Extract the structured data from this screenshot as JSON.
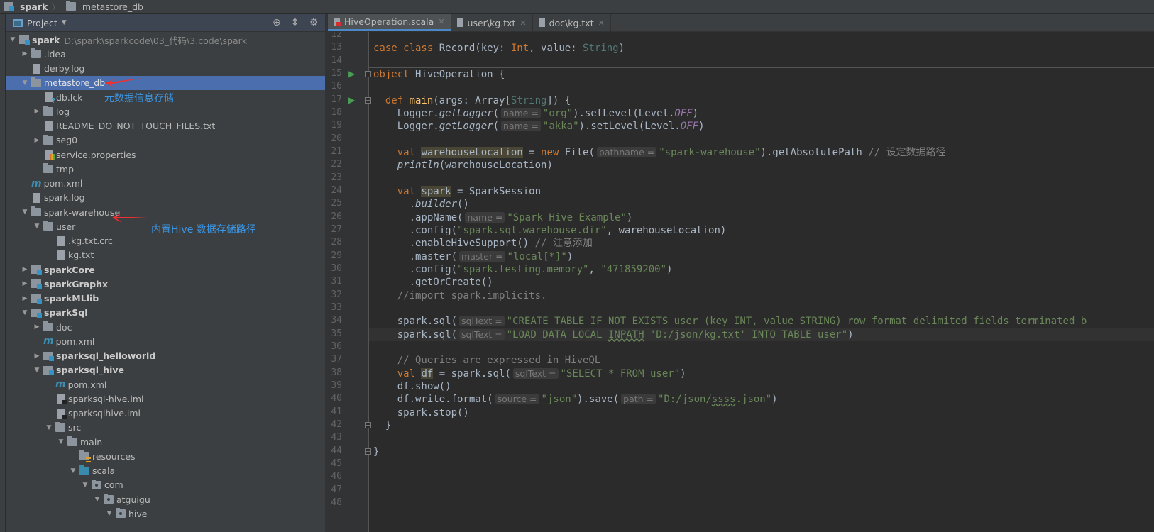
{
  "breadcrumb": {
    "project": "spark",
    "folder": "metastore_db"
  },
  "project_panel": {
    "title": "Project",
    "icons": [
      "locate-icon",
      "collapse-icon",
      "gear-icon"
    ]
  },
  "tree": [
    {
      "label": "spark",
      "level": 0,
      "arrow": "open",
      "icon": "module",
      "bold": true,
      "path": "D:\\spark\\sparkcode\\03_代码\\3.code\\spark"
    },
    {
      "label": ".idea",
      "level": 1,
      "arrow": "closed",
      "icon": "folder"
    },
    {
      "label": "derby.log",
      "level": 1,
      "arrow": "",
      "icon": "file"
    },
    {
      "label": "metastore_db",
      "level": 1,
      "arrow": "open",
      "icon": "folder",
      "selected": true
    },
    {
      "label": "db.lck",
      "level": 2,
      "arrow": "",
      "icon": "lock"
    },
    {
      "label": "log",
      "level": 2,
      "arrow": "closed",
      "icon": "folder"
    },
    {
      "label": "README_DO_NOT_TOUCH_FILES.txt",
      "level": 2,
      "arrow": "",
      "icon": "file"
    },
    {
      "label": "seg0",
      "level": 2,
      "arrow": "closed",
      "icon": "folder"
    },
    {
      "label": "service.properties",
      "level": 2,
      "arrow": "",
      "icon": "props"
    },
    {
      "label": "tmp",
      "level": 2,
      "arrow": "",
      "icon": "folder"
    },
    {
      "label": "pom.xml",
      "level": 1,
      "arrow": "",
      "icon": "maven"
    },
    {
      "label": "spark.log",
      "level": 1,
      "arrow": "",
      "icon": "file"
    },
    {
      "label": "spark-warehouse",
      "level": 1,
      "arrow": "open",
      "icon": "folder"
    },
    {
      "label": "user",
      "level": 2,
      "arrow": "open",
      "icon": "folder"
    },
    {
      "label": ".kg.txt.crc",
      "level": 3,
      "arrow": "",
      "icon": "file"
    },
    {
      "label": "kg.txt",
      "level": 3,
      "arrow": "",
      "icon": "file"
    },
    {
      "label": "sparkCore",
      "level": 1,
      "arrow": "closed",
      "icon": "module",
      "bold": true
    },
    {
      "label": "sparkGraphx",
      "level": 1,
      "arrow": "closed",
      "icon": "module",
      "bold": true
    },
    {
      "label": "sparkMLlib",
      "level": 1,
      "arrow": "closed",
      "icon": "module",
      "bold": true
    },
    {
      "label": "sparkSql",
      "level": 1,
      "arrow": "open",
      "icon": "module",
      "bold": true
    },
    {
      "label": "doc",
      "level": 2,
      "arrow": "closed",
      "icon": "folder"
    },
    {
      "label": "pom.xml",
      "level": 2,
      "arrow": "",
      "icon": "maven"
    },
    {
      "label": "sparksql_helloworld",
      "level": 2,
      "arrow": "closed",
      "icon": "module",
      "bold": true
    },
    {
      "label": "sparksql_hive",
      "level": 2,
      "arrow": "open",
      "icon": "module",
      "bold": true
    },
    {
      "label": "pom.xml",
      "level": 3,
      "arrow": "",
      "icon": "maven"
    },
    {
      "label": "sparksql-hive.iml",
      "level": 3,
      "arrow": "",
      "icon": "iml"
    },
    {
      "label": "sparksqlhive.iml",
      "level": 3,
      "arrow": "",
      "icon": "iml"
    },
    {
      "label": "src",
      "level": 3,
      "arrow": "open",
      "icon": "folder"
    },
    {
      "label": "main",
      "level": 4,
      "arrow": "open",
      "icon": "folder"
    },
    {
      "label": "resources",
      "level": 5,
      "arrow": "",
      "icon": "res"
    },
    {
      "label": "scala",
      "level": 5,
      "arrow": "open",
      "icon": "src"
    },
    {
      "label": "com",
      "level": 6,
      "arrow": "open",
      "icon": "pkg"
    },
    {
      "label": "atguigu",
      "level": 7,
      "arrow": "open",
      "icon": "pkg"
    },
    {
      "label": "hive",
      "level": 8,
      "arrow": "open",
      "icon": "pkg"
    }
  ],
  "annotations": {
    "metastore_note": "元数据信息存储",
    "warehouse_note": "内置Hive 数据存储路径",
    "arrow_color": "#f03030"
  },
  "tabs": [
    {
      "label": "HiveOperation.scala",
      "active": true,
      "icon": "scala"
    },
    {
      "label": "user\\kg.txt",
      "icon": "text"
    },
    {
      "label": "doc\\kg.txt",
      "icon": "text"
    }
  ],
  "editor": {
    "first_line": 12,
    "current_line": 35,
    "run_lines": [
      15,
      17
    ],
    "fold_lines": [
      15,
      17,
      42,
      44
    ],
    "lines": [
      [],
      [
        [
          "kw",
          "case class "
        ],
        [
          "p",
          "Record(key: "
        ],
        [
          "kw",
          "Int"
        ],
        [
          "p",
          ", value: "
        ],
        [
          "ty",
          "String"
        ],
        [
          "p",
          ")"
        ]
      ],
      [],
      [
        [
          "kw",
          "object "
        ],
        [
          "p",
          "HiveOperation {"
        ]
      ],
      [],
      [
        [
          "p",
          "  "
        ],
        [
          "kw",
          "def "
        ],
        [
          "fn",
          "main"
        ],
        [
          "p",
          "(args: Array["
        ],
        [
          "ty",
          "String"
        ],
        [
          "p",
          "]) {"
        ]
      ],
      [
        [
          "p",
          "    Logger."
        ],
        [
          "it",
          "getLogger"
        ],
        [
          "p",
          "("
        ],
        [
          "hint",
          "name ="
        ],
        [
          "str",
          "\"org\""
        ],
        [
          "p",
          ").setLevel(Level."
        ],
        [
          "const",
          "OFF"
        ],
        [
          "p",
          ")"
        ]
      ],
      [
        [
          "p",
          "    Logger."
        ],
        [
          "it",
          "getLogger"
        ],
        [
          "p",
          "("
        ],
        [
          "hint",
          "name ="
        ],
        [
          "str",
          "\"akka\""
        ],
        [
          "p",
          ").setLevel(Level."
        ],
        [
          "const",
          "OFF"
        ],
        [
          "p",
          ")"
        ]
      ],
      [],
      [
        [
          "p",
          "    "
        ],
        [
          "kw",
          "val "
        ],
        [
          "hl",
          "warehouseLocation"
        ],
        [
          "p",
          " = "
        ],
        [
          "kw",
          "new "
        ],
        [
          "p",
          "File("
        ],
        [
          "hint",
          "pathname ="
        ],
        [
          "str",
          "\"spark-warehouse\""
        ],
        [
          "p",
          ").getAbsolutePath "
        ],
        [
          "cm",
          "// 设定数据路径"
        ]
      ],
      [
        [
          "p",
          "    "
        ],
        [
          "it",
          "println"
        ],
        [
          "p",
          "(warehouseLocation)"
        ]
      ],
      [],
      [
        [
          "p",
          "    "
        ],
        [
          "kw",
          "val "
        ],
        [
          "hl",
          "spark"
        ],
        [
          "p",
          " = SparkSession"
        ]
      ],
      [
        [
          "p",
          "      ."
        ],
        [
          "it",
          "builder"
        ],
        [
          "p",
          "()"
        ]
      ],
      [
        [
          "p",
          "      .appName("
        ],
        [
          "hint",
          "name ="
        ],
        [
          "str",
          "\"Spark Hive Example\""
        ],
        [
          "p",
          ")"
        ]
      ],
      [
        [
          "p",
          "      .config("
        ],
        [
          "str",
          "\"spark.sql.warehouse.dir\""
        ],
        [
          "p",
          ", warehouseLocation)"
        ]
      ],
      [
        [
          "p",
          "      .enableHiveSupport() "
        ],
        [
          "cm",
          "// 注意添加"
        ]
      ],
      [
        [
          "p",
          "      .master("
        ],
        [
          "hint",
          "master ="
        ],
        [
          "str",
          "\"local[*]\""
        ],
        [
          "p",
          ")"
        ]
      ],
      [
        [
          "p",
          "      .config("
        ],
        [
          "str",
          "\"spark.testing.memory\""
        ],
        [
          "p",
          ", "
        ],
        [
          "str",
          "\"471859200\""
        ],
        [
          "p",
          ")"
        ]
      ],
      [
        [
          "p",
          "      .getOrCreate()"
        ]
      ],
      [
        [
          "cm",
          "    //import spark.implicits._"
        ]
      ],
      [],
      [
        [
          "p",
          "    spark.sql("
        ],
        [
          "hint",
          "sqlText ="
        ],
        [
          "str",
          "\"CREATE TABLE IF NOT EXISTS user (key INT, value STRING) row format delimited fields terminated b"
        ]
      ],
      [
        [
          "p",
          "    spark.sql("
        ],
        [
          "hint",
          "sqlText ="
        ],
        [
          "str",
          "\"LOAD DATA LOCAL "
        ],
        [
          "strw",
          "INPATH"
        ],
        [
          "str",
          " 'D:/json/kg.txt' INTO TABLE user\""
        ],
        [
          "p",
          ")"
        ]
      ],
      [],
      [
        [
          "cm",
          "    // Queries are expressed in HiveQL"
        ]
      ],
      [
        [
          "p",
          "    "
        ],
        [
          "kw",
          "val "
        ],
        [
          "hl",
          "df"
        ],
        [
          "p",
          " = spark.sql("
        ],
        [
          "hint",
          "sqlText ="
        ],
        [
          "str",
          "\"SELECT * FROM user\""
        ],
        [
          "p",
          ")"
        ]
      ],
      [
        [
          "p",
          "    df.show()"
        ]
      ],
      [
        [
          "p",
          "    df.write.format("
        ],
        [
          "hint",
          "source ="
        ],
        [
          "str",
          "\"json\""
        ],
        [
          "p",
          ").save("
        ],
        [
          "hint",
          "path ="
        ],
        [
          "str",
          "\"D:/json/"
        ],
        [
          "strw",
          "ssss"
        ],
        [
          "str",
          ".json\""
        ],
        [
          "p",
          ")"
        ]
      ],
      [
        [
          "p",
          "    spark.stop()"
        ]
      ],
      [
        [
          "p",
          "  }"
        ]
      ],
      [],
      [
        [
          "p",
          "}"
        ]
      ],
      [],
      [],
      [],
      []
    ]
  }
}
